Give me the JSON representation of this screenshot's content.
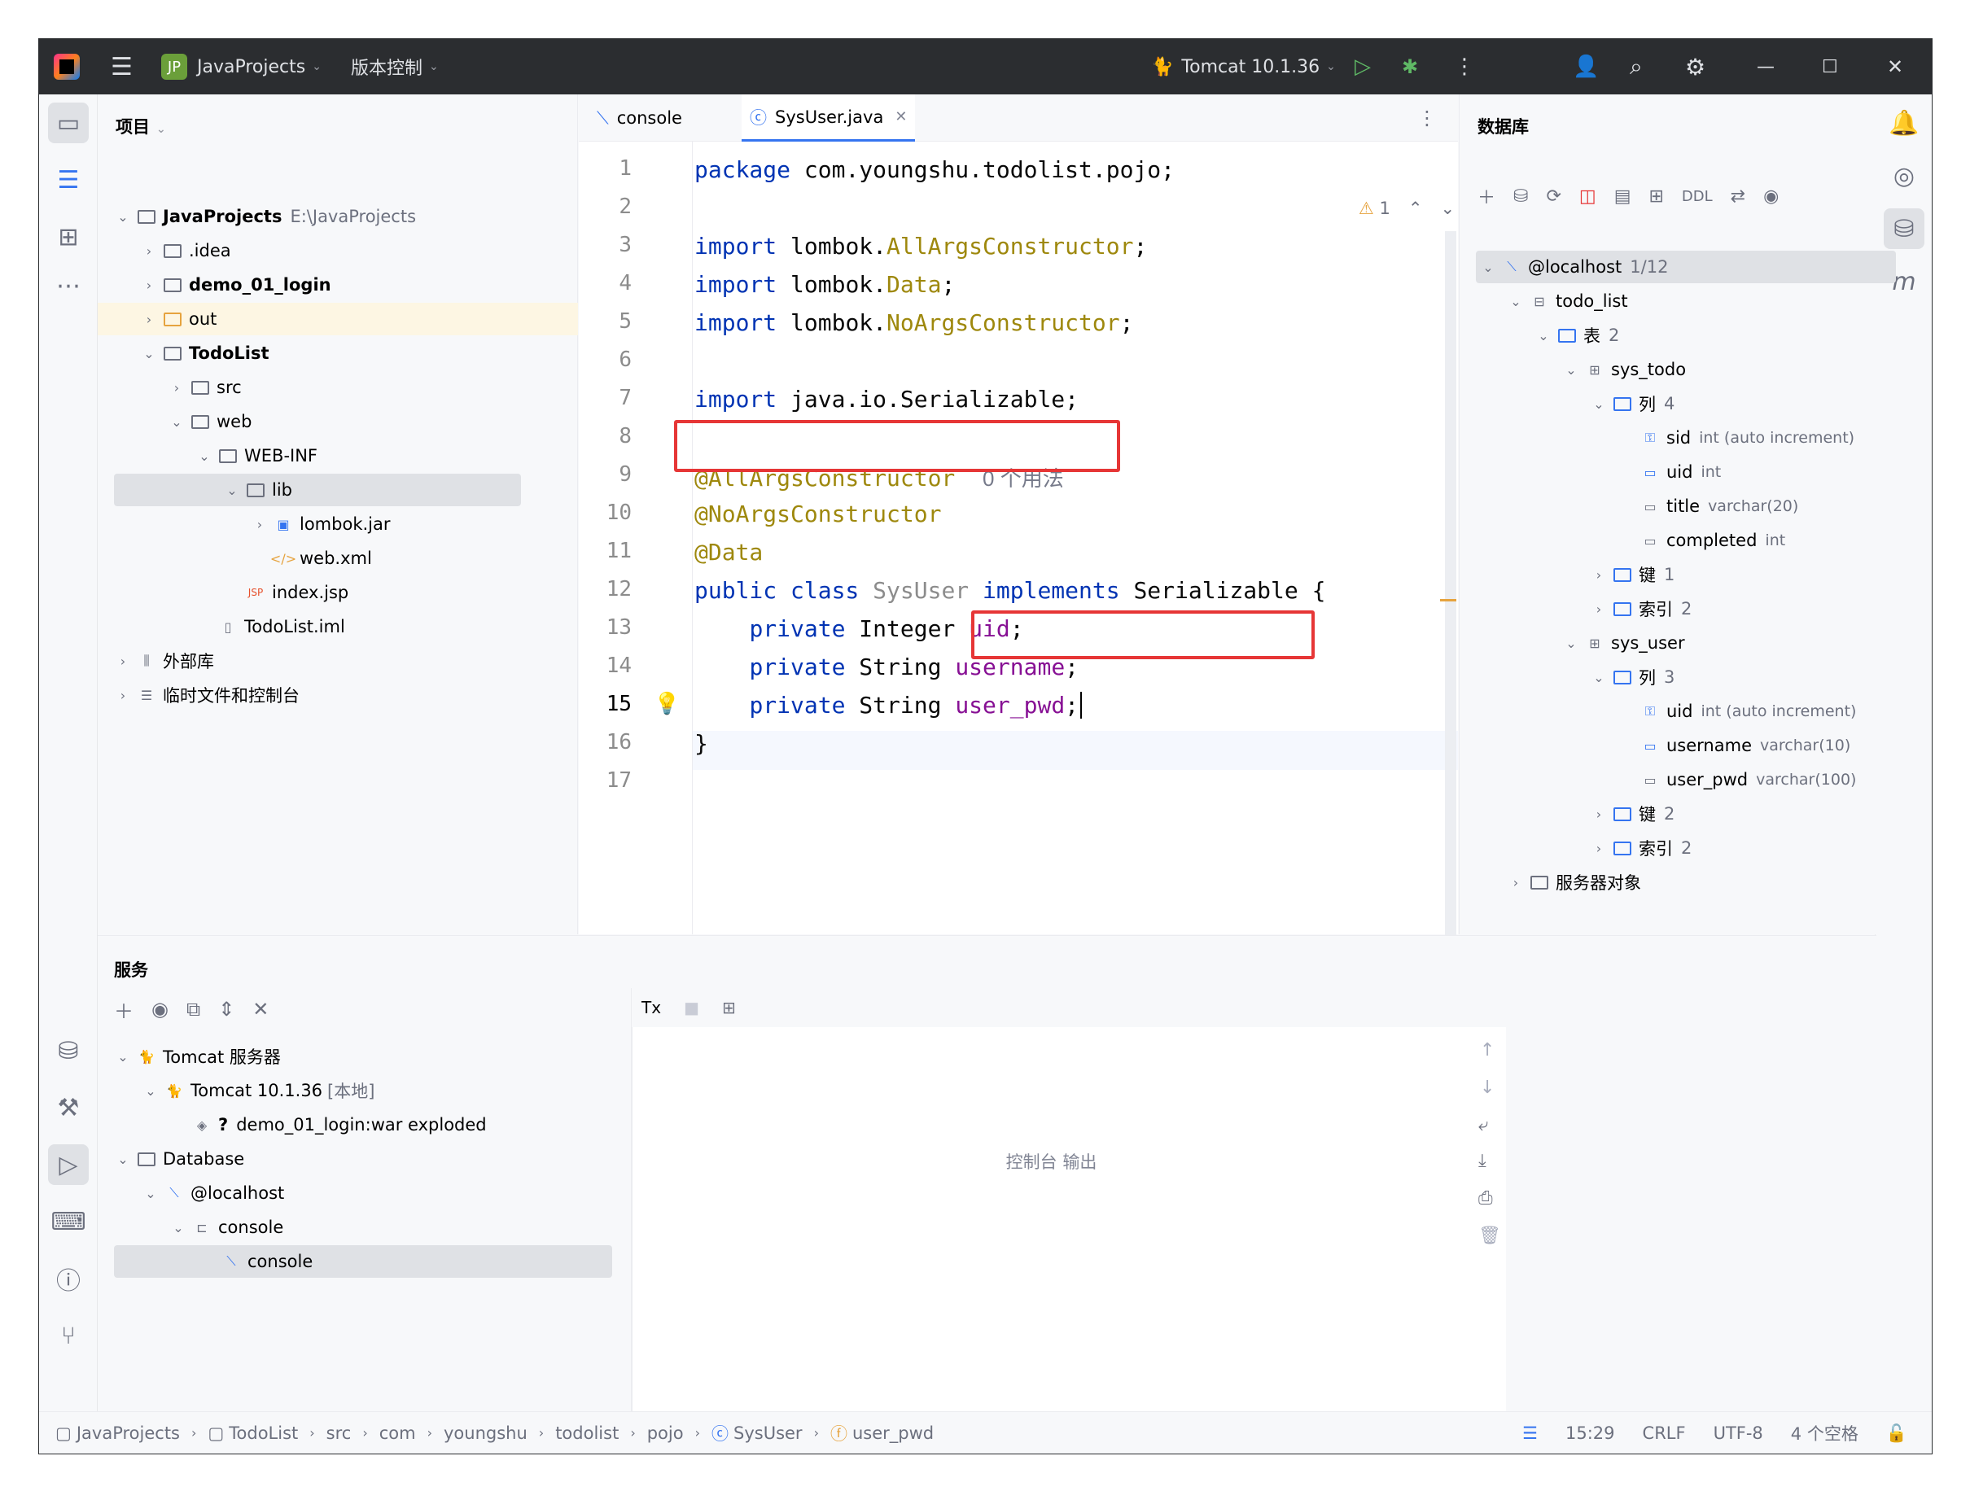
{
  "titlebar": {
    "project_badge": "JP",
    "project": "JavaProjects",
    "vcs": "版本控制",
    "run_config": "Tomcat 10.1.36"
  },
  "project_panel": {
    "title": "项目",
    "tree": [
      {
        "label": "JavaProjects",
        "extra": "E:\\JavaProjects",
        "bold": true
      },
      {
        "label": ".idea"
      },
      {
        "label": "demo_01_login",
        "bold": true
      },
      {
        "label": "out"
      },
      {
        "label": "TodoList",
        "bold": true
      },
      {
        "label": "src"
      },
      {
        "label": "web"
      },
      {
        "label": "WEB-INF"
      },
      {
        "label": "lib"
      },
      {
        "label": "lombok.jar"
      },
      {
        "label": "web.xml"
      },
      {
        "label": "index.jsp"
      },
      {
        "label": "TodoList.iml"
      },
      {
        "label": "外部库"
      },
      {
        "label": "临时文件和控制台"
      }
    ]
  },
  "editor": {
    "tabs": [
      {
        "label": "console"
      },
      {
        "label": "SysUser.java"
      }
    ],
    "warnings": "1",
    "line_numbers": [
      "1",
      "2",
      "3",
      "4",
      "5",
      "6",
      "7",
      "8",
      "9",
      "10",
      "11",
      "12",
      "13",
      "14",
      "15",
      "16",
      "17"
    ],
    "code": {
      "l1_kw": "package",
      "l1_rest": " com.youngshu.todolist.pojo;",
      "import_kw": "import",
      "l3_a": " lombok.",
      "l3_b": "AllArgsConstructor",
      "l3_c": ";",
      "l4_a": " lombok.",
      "l4_b": "Data",
      "l4_c": ";",
      "l5_a": " lombok.",
      "l5_b": "NoArgsConstructor",
      "l5_c": ";",
      "l7_rest": " java.io.Serializable;",
      "l9_ann": "@AllArgsConstructor",
      "l9_hint": "0 个用法",
      "l10_ann": "@NoArgsConstructor",
      "l11_ann": "@Data",
      "l12_kw": "public class",
      "l12_cls": " SysUser ",
      "l12_impl": "implements",
      "l12_iface": " Serializable",
      "l12_brace": " {",
      "private_kw": "private",
      "l13_type": " Integer ",
      "l13_field": "uid",
      "semicolon": ";",
      "l14_type": " String ",
      "l14_field": "username",
      "l15_type": " String ",
      "l15_field": "user_pwd",
      "l16": "}"
    }
  },
  "database_panel": {
    "title": "数据库",
    "ddl": "DDL",
    "tree": [
      {
        "label": "@localhost",
        "extra": "1/12"
      },
      {
        "label": "todo_list"
      },
      {
        "label": "表",
        "extra": "2"
      },
      {
        "label": "sys_todo"
      },
      {
        "label": "列",
        "extra": "4"
      },
      {
        "label": "sid",
        "extra": "int (auto increment)"
      },
      {
        "label": "uid",
        "extra": "int"
      },
      {
        "label": "title",
        "extra": "varchar(20)"
      },
      {
        "label": "completed",
        "extra": "int"
      },
      {
        "label": "键",
        "extra": "1"
      },
      {
        "label": "索引",
        "extra": "2"
      },
      {
        "label": "sys_user"
      },
      {
        "label": "列",
        "extra": "3"
      },
      {
        "label": "uid",
        "extra": "int (auto increment)"
      },
      {
        "label": "username",
        "extra": "varchar(10)"
      },
      {
        "label": "user_pwd",
        "extra": "varchar(100)"
      },
      {
        "label": "键",
        "extra": "2"
      },
      {
        "label": "索引",
        "extra": "2"
      },
      {
        "label": "服务器对象"
      }
    ]
  },
  "services_panel": {
    "title": "服务",
    "tree": [
      {
        "label": "Tomcat 服务器"
      },
      {
        "label": "Tomcat 10.1.36",
        "extra": "[本地]"
      },
      {
        "label": "demo_01_login:war exploded"
      },
      {
        "label": "Database"
      },
      {
        "label": "@localhost"
      },
      {
        "label": "console"
      },
      {
        "label": "console"
      }
    ],
    "console_tx": "Tx",
    "console_empty": "控制台 输出"
  },
  "statusbar": {
    "breadcrumbs": [
      "JavaProjects",
      "TodoList",
      "src",
      "com",
      "youngshu",
      "todolist",
      "pojo",
      "SysUser",
      "user_pwd"
    ],
    "position": "15:29",
    "line_sep": "CRLF",
    "encoding": "UTF-8",
    "indent": "4 个空格"
  },
  "colors": {
    "highlight_box": "#e63636",
    "keyword": "#0033b3",
    "annotation": "#9e880d",
    "field": "#871094"
  }
}
